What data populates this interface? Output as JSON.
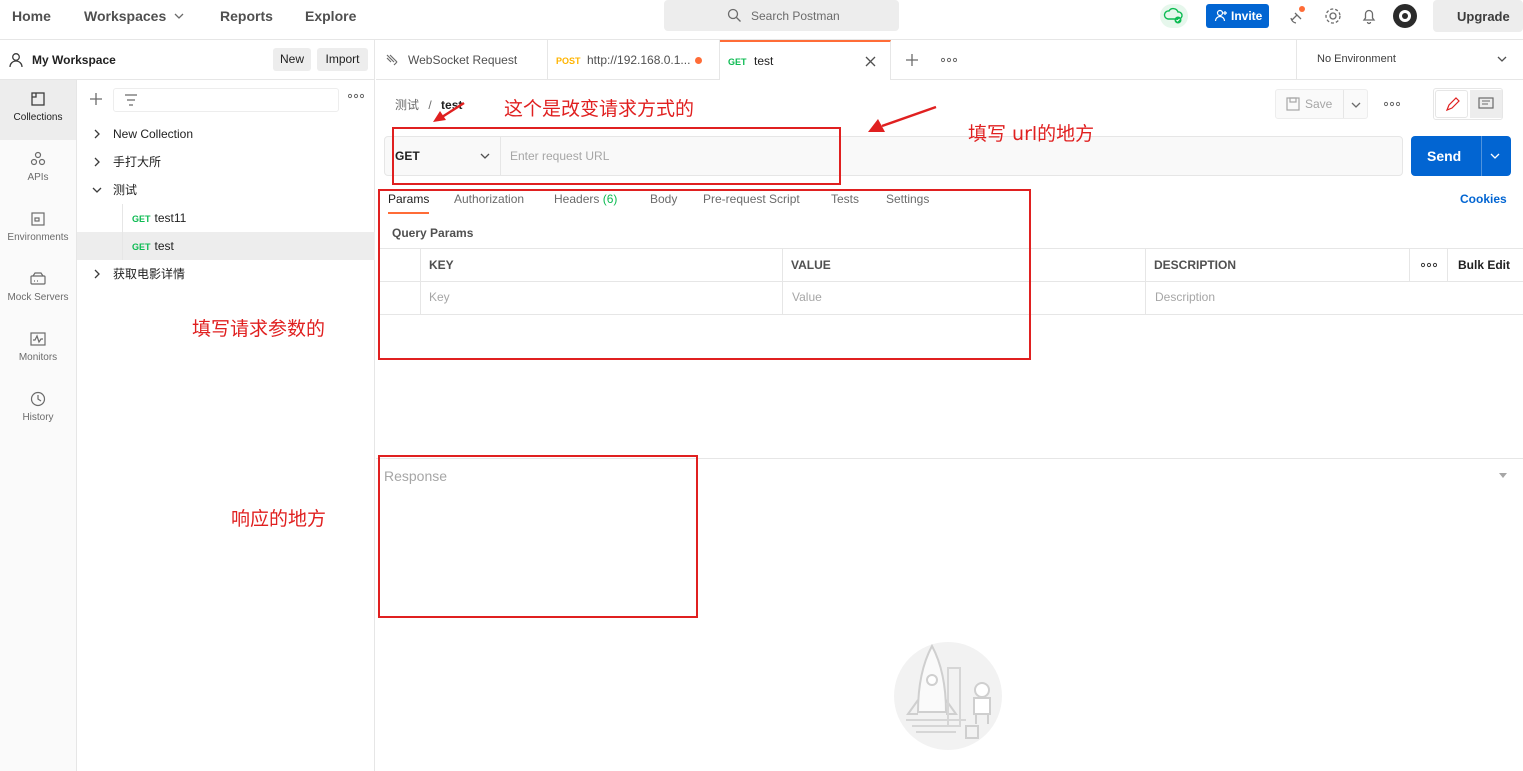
{
  "topbar": {
    "nav": [
      "Home",
      "Workspaces",
      "Reports",
      "Explore"
    ],
    "search_placeholder": "Search Postman",
    "invite_label": "Invite",
    "upgrade_label": "Upgrade"
  },
  "workspace": {
    "name": "My Workspace",
    "new_label": "New",
    "import_label": "Import"
  },
  "rail": [
    "Collections",
    "APIs",
    "Environments",
    "Mock Servers",
    "Monitors",
    "History"
  ],
  "tree": {
    "items": [
      {
        "label": "New Collection"
      },
      {
        "label": "手打大所"
      },
      {
        "label": "测试"
      },
      {
        "method": "GET",
        "label": "test11"
      },
      {
        "method": "GET",
        "label": "test"
      },
      {
        "label": "获取电影详情"
      }
    ]
  },
  "tabs": [
    {
      "label": "WebSocket Request"
    },
    {
      "method": "POST",
      "label": "http://192.168.0.1..."
    },
    {
      "method": "GET",
      "label": "test"
    }
  ],
  "environment": "No Environment",
  "breadcrumb": {
    "parent": "测试",
    "sep": "/",
    "current": "test"
  },
  "toolbar": {
    "save_label": "Save"
  },
  "request": {
    "method": "GET",
    "url_placeholder": "Enter request URL",
    "send_label": "Send"
  },
  "subtabs": {
    "params": "Params",
    "authorization": "Authorization",
    "headers": "Headers",
    "headers_count": "(6)",
    "body": "Body",
    "prerequest": "Pre-request Script",
    "tests": "Tests",
    "settings": "Settings",
    "cookies": "Cookies"
  },
  "params": {
    "title": "Query Params",
    "headers": {
      "key": "KEY",
      "value": "VALUE",
      "description": "DESCRIPTION",
      "bulk": "Bulk Edit"
    },
    "placeholders": {
      "key": "Key",
      "value": "Value",
      "description": "Description"
    }
  },
  "response": {
    "title": "Response"
  },
  "annotations": {
    "method": "这个是改变请求方式的",
    "url": "填写 url的地方",
    "params": "填写请求参数的",
    "response": "响应的地方"
  },
  "colors": {
    "accent": "#ff6c37",
    "primary": "#0265d2",
    "annotation": "#e02020",
    "get": "#0cbb52",
    "post": "#ffb400"
  }
}
